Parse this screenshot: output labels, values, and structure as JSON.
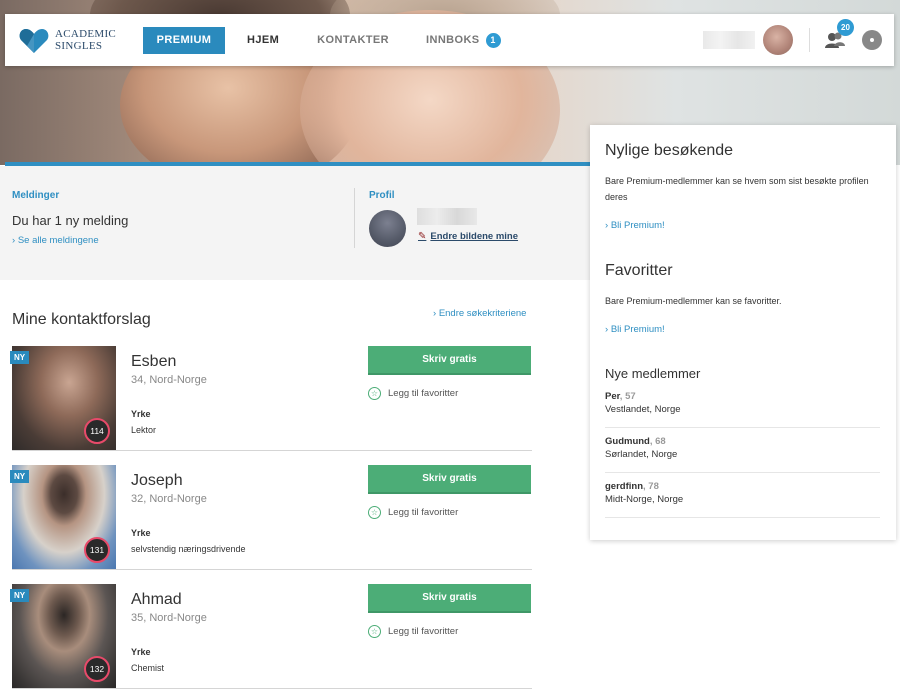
{
  "header": {
    "logo_line1": "ACADEMIC",
    "logo_line2": "SINGLES",
    "nav": {
      "premium": "PREMIUM",
      "hjem": "HJEM",
      "kontakter": "KONTAKTER",
      "innboks": "INNBOKS",
      "innboks_count": "1"
    },
    "contacts_count": "20",
    "icons": [
      "heart-logo-icon",
      "contacts-icon",
      "eye-icon"
    ]
  },
  "messages": {
    "label": "Meldinger",
    "text": "Du har 1 ny melding",
    "link": "Se alle meldingene"
  },
  "profile": {
    "label": "Profil",
    "edit_link": "Endre bildene mine"
  },
  "suggestions": {
    "title": "Mine kontaktforslag",
    "criteria_link": "Endre søkekriteriene",
    "items": [
      {
        "badge": "NY",
        "score": "114",
        "name": "Esben",
        "location": "34, Nord-Norge",
        "job_label": "Yrke",
        "job": "Lektor",
        "write_label": "Skriv gratis",
        "fav_label": "Legg til favoritter"
      },
      {
        "badge": "NY",
        "score": "131",
        "name": "Joseph",
        "location": "32, Nord-Norge",
        "job_label": "Yrke",
        "job": "selvstendig næringsdrivende",
        "write_label": "Skriv gratis",
        "fav_label": "Legg til favoritter"
      },
      {
        "badge": "NY",
        "score": "132",
        "name": "Ahmad",
        "location": "35, Nord-Norge",
        "job_label": "Yrke",
        "job": "Chemist",
        "write_label": "Skriv gratis",
        "fav_label": "Legg til favoritter"
      }
    ]
  },
  "sidebar": {
    "visitors": {
      "title": "Nylige besøkende",
      "text": "Bare Premium-medlemmer kan se hvem som sist besøkte profilen deres",
      "link": "Bli Premium!"
    },
    "favorites": {
      "title": "Favoritter",
      "text": "Bare Premium-medlemmer kan se favoritter.",
      "link": "Bli Premium!"
    },
    "new_members": {
      "title": "Nye medlemmer",
      "items": [
        {
          "name": "Per",
          "age": "57",
          "location": "Vestlandet, Norge"
        },
        {
          "name": "Gudmund",
          "age": "68",
          "location": "Sørlandet, Norge"
        },
        {
          "name": "gerdfinn",
          "age": "78",
          "location": "Midt-Norge, Norge"
        }
      ]
    }
  },
  "colors": {
    "accent": "#2a8abd",
    "button_green": "#4cad77",
    "score_ring": "#e84a6a"
  }
}
